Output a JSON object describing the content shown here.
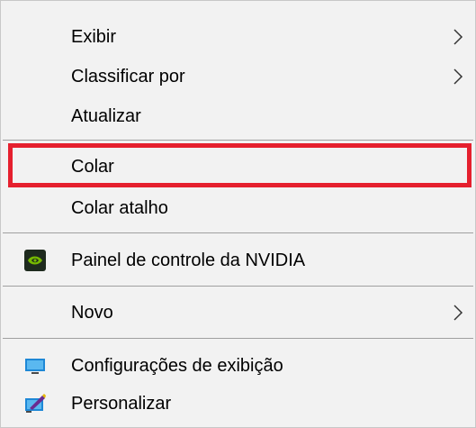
{
  "context_menu": {
    "items": [
      {
        "label": "Exibir",
        "has_submenu": true
      },
      {
        "label": "Classificar por",
        "has_submenu": true
      },
      {
        "label": "Atualizar",
        "has_submenu": false
      },
      {
        "label": "Colar",
        "has_submenu": false,
        "highlighted": true
      },
      {
        "label": "Colar atalho",
        "has_submenu": false
      },
      {
        "label": "Painel de controle da NVIDIA",
        "has_submenu": false,
        "icon": "nvidia-icon"
      },
      {
        "label": "Novo",
        "has_submenu": true
      },
      {
        "label": "Configurações de exibição",
        "has_submenu": false,
        "icon": "display-settings-icon"
      },
      {
        "label": "Personalizar",
        "has_submenu": false,
        "icon": "personalize-icon"
      }
    ],
    "highlight_color": "#e5202e",
    "nvidia_green": "#76b900"
  }
}
